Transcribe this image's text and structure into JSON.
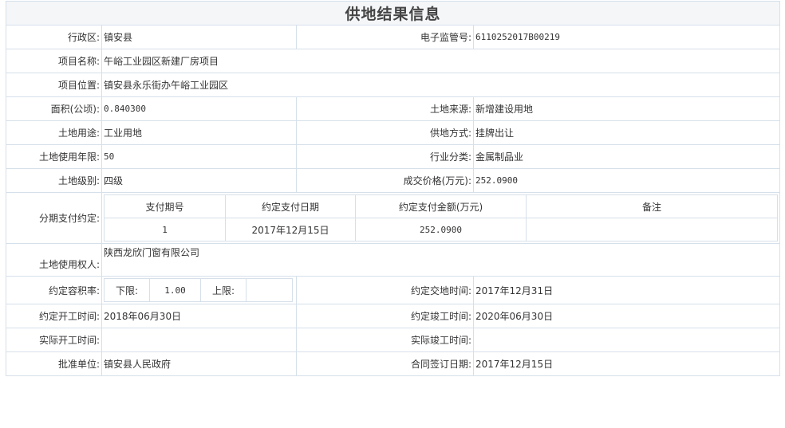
{
  "title": "供地结果信息",
  "fields": {
    "district_label": "行政区:",
    "district_value": "镇安县",
    "supervision_no_label": "电子监管号:",
    "supervision_no_value": "6110252017B00219",
    "project_name_label": "项目名称:",
    "project_name_value": "午峪工业园区新建厂房项目",
    "project_location_label": "项目位置:",
    "project_location_value": "镇安县永乐街办午峪工业园区",
    "area_label": "面积(公顷):",
    "area_value": "0.840300",
    "land_source_label": "土地来源:",
    "land_source_value": "新增建设用地",
    "land_use_label": "土地用途:",
    "land_use_value": "工业用地",
    "supply_method_label": "供地方式:",
    "supply_method_value": "挂牌出让",
    "use_years_label": "土地使用年限:",
    "use_years_value": "50",
    "industry_label": "行业分类:",
    "industry_value": "金属制品业",
    "land_grade_label": "土地级别:",
    "land_grade_value": "四级",
    "price_label": "成交价格(万元):",
    "price_value": "252.0900",
    "installment_label": "分期支付约定:",
    "land_user_label": "土地使用权人:",
    "land_user_value": "陕西龙欣门窗有限公司",
    "far_label": "约定容积率:",
    "far_lower_label": "下限:",
    "far_lower_value": "1.00",
    "far_upper_label": "上限:",
    "far_upper_value": "",
    "delivery_time_label": "约定交地时间:",
    "delivery_time_value": "2017年12月31日",
    "start_time_label": "约定开工时间:",
    "start_time_value": "2018年06月30日",
    "complete_time_label": "约定竣工时间:",
    "complete_time_value": "2020年06月30日",
    "actual_start_label": "实际开工时间:",
    "actual_start_value": "",
    "actual_complete_label": "实际竣工时间:",
    "actual_complete_value": "",
    "approval_unit_label": "批准单位:",
    "approval_unit_value": "镇安县人民政府",
    "contract_date_label": "合同签订日期:",
    "contract_date_value": "2017年12月15日"
  },
  "installments": {
    "headers": [
      "支付期号",
      "约定支付日期",
      "约定支付金额(万元)",
      "备注"
    ],
    "rows": [
      [
        "1",
        "2017年12月15日",
        "252.0900",
        ""
      ]
    ]
  }
}
